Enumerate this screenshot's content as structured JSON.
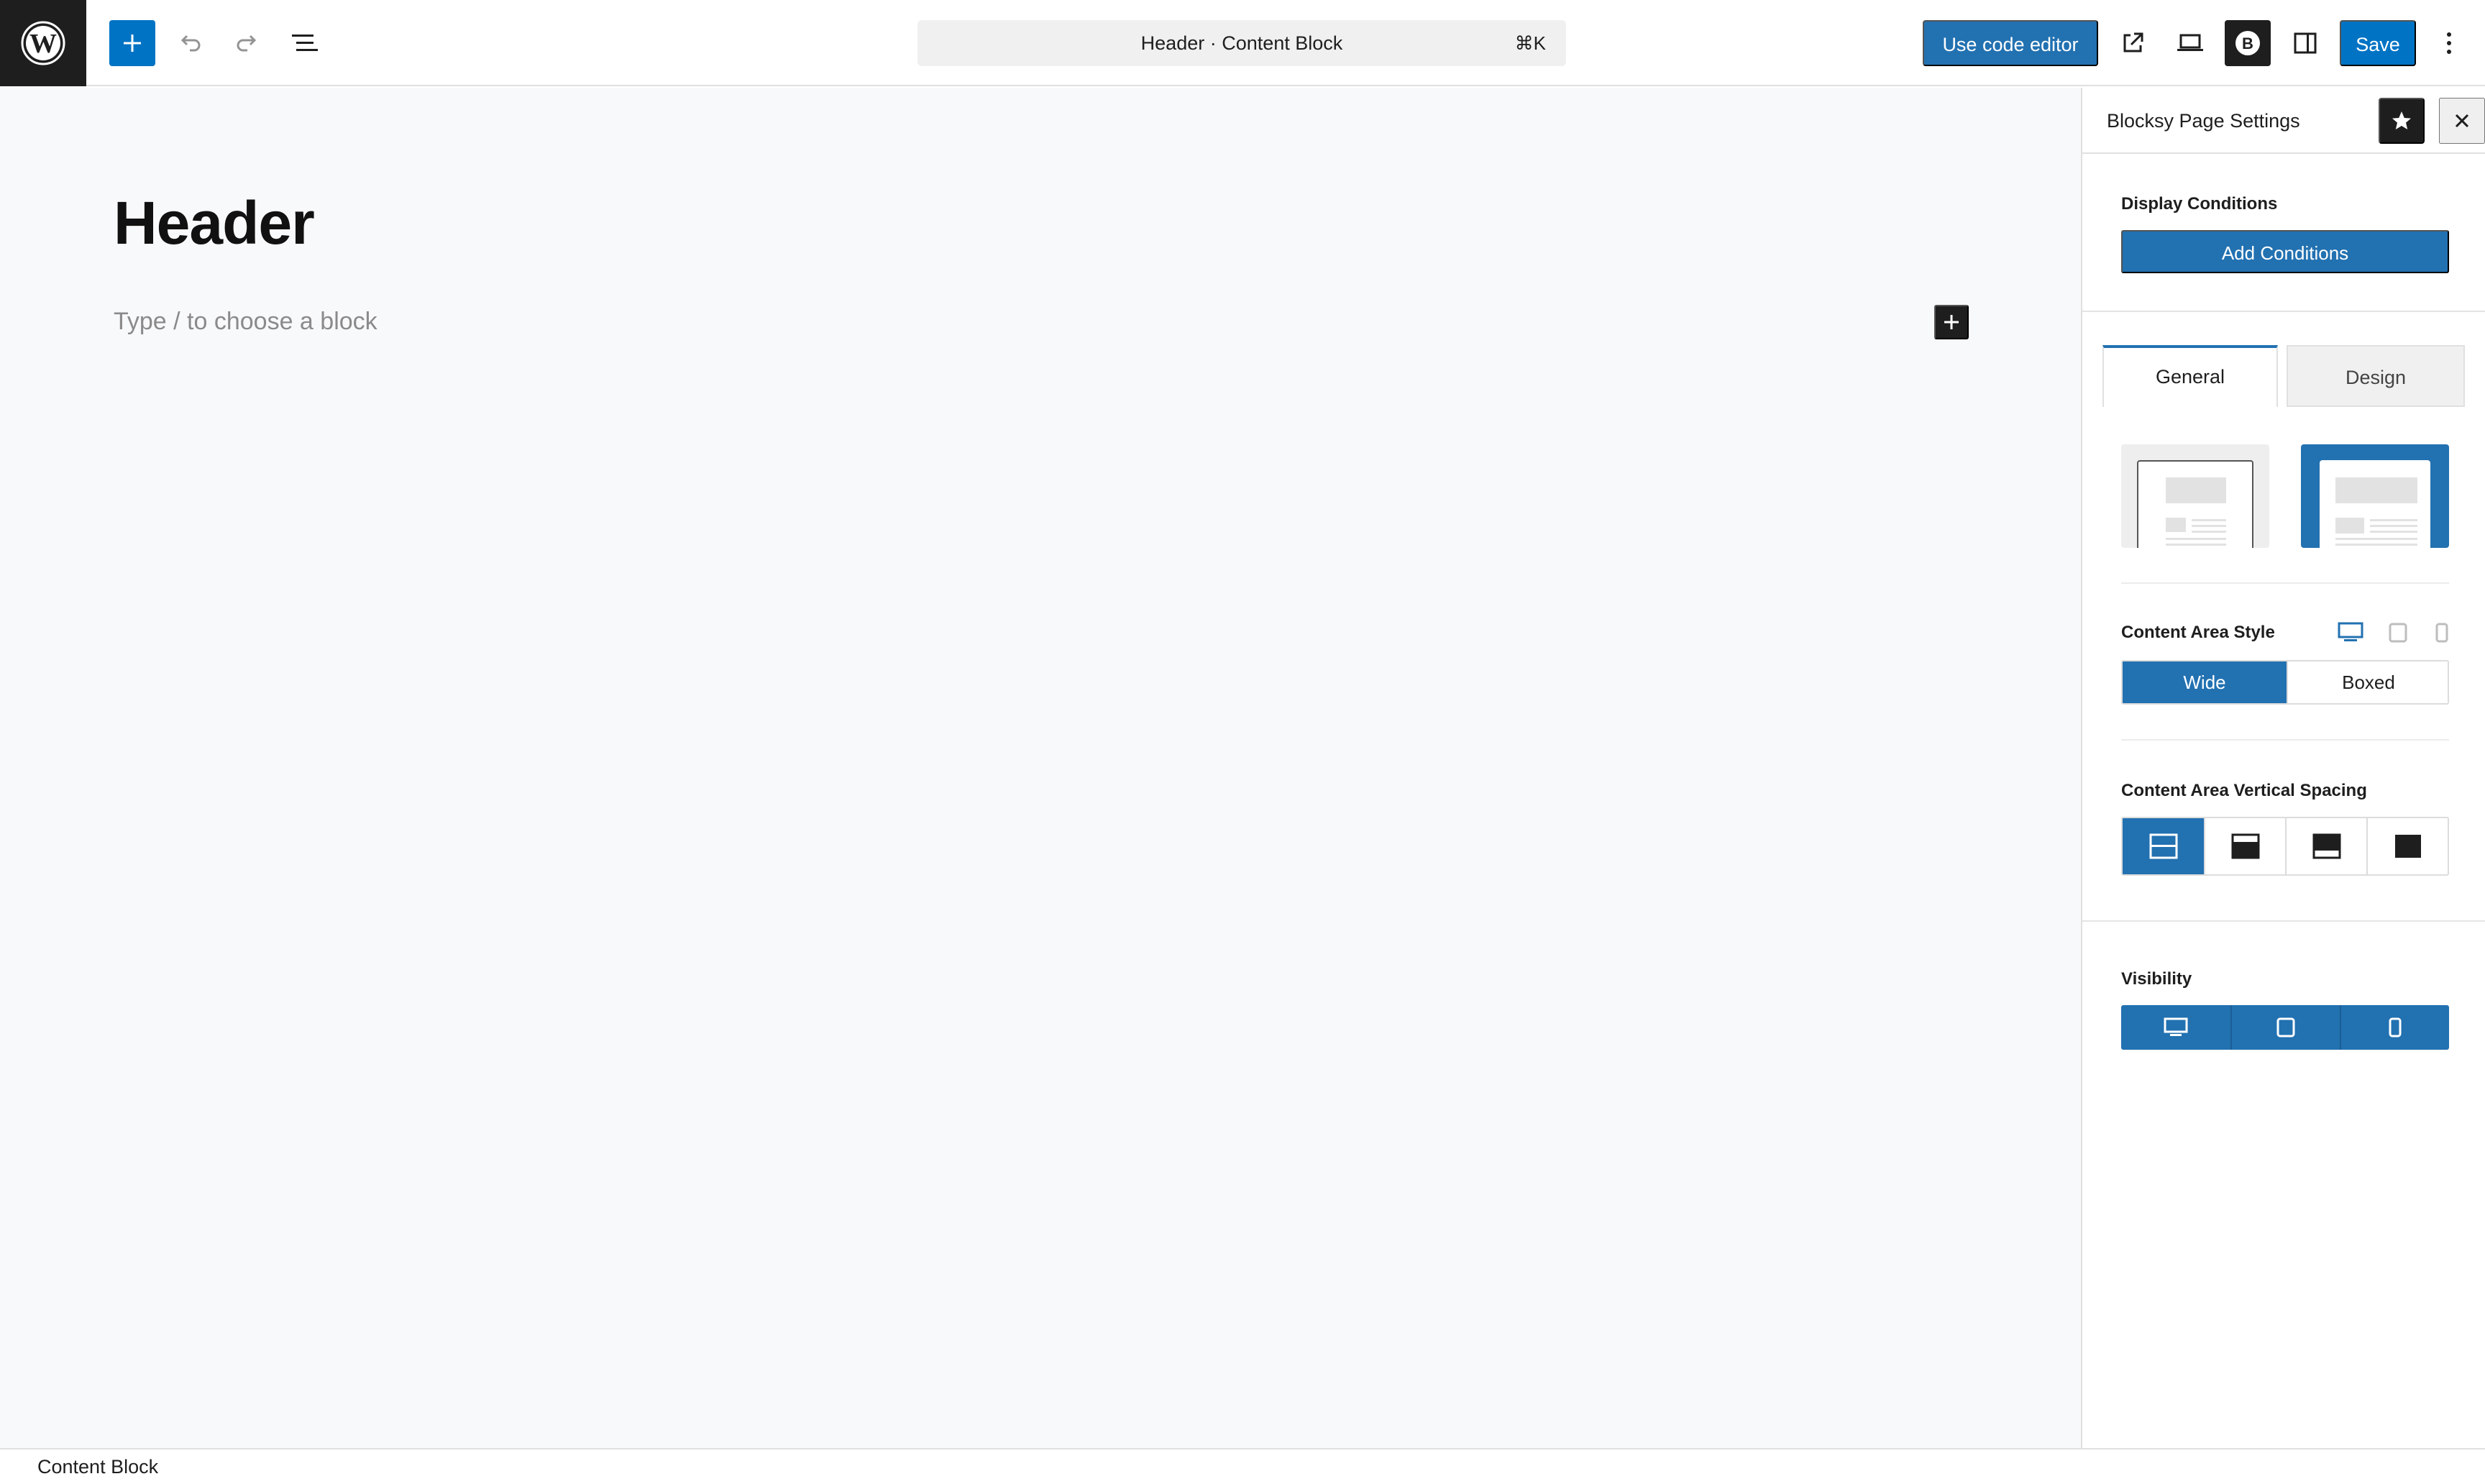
{
  "toolbar": {
    "command_bar_title": "Header · Content Block",
    "command_bar_shortcut": "⌘K",
    "code_editor_label": "Use code editor",
    "save_label": "Save"
  },
  "icons": {
    "logo": "wordpress-logo-icon",
    "add": "plus-icon",
    "undo": "undo-icon",
    "redo": "redo-icon",
    "document_overview": "list-view-icon",
    "view_page": "external-link-icon",
    "device_preview": "laptop-icon",
    "blocksy": "blocksy-b-icon",
    "settings_sidebar": "sidebar-toggle-icon",
    "more": "kebab-menu-icon",
    "pin": "star-icon",
    "close": "close-icon"
  },
  "editor": {
    "title": "Header",
    "placeholder": "Type / to choose a block"
  },
  "sidebar": {
    "title": "Blocksy Page Settings",
    "display_conditions_label": "Display Conditions",
    "add_conditions_label": "Add Conditions",
    "tabs": [
      {
        "label": "General",
        "active": true
      },
      {
        "label": "Design",
        "active": false
      }
    ],
    "layout_selected": 2,
    "content_area_style": {
      "label": "Content Area Style",
      "options": [
        "Wide",
        "Boxed"
      ],
      "selected": "Wide",
      "active_device": "desktop"
    },
    "vertical_spacing": {
      "label": "Content Area Vertical Spacing",
      "selected_index": 0
    },
    "visibility": {
      "label": "Visibility",
      "devices": [
        "desktop",
        "tablet",
        "mobile"
      ]
    }
  },
  "footer": {
    "breadcrumb": "Content Block"
  },
  "colors": {
    "accent": "#2271b1",
    "dark": "#1e1e1e",
    "canvas_bg": "#f8f9fb"
  }
}
